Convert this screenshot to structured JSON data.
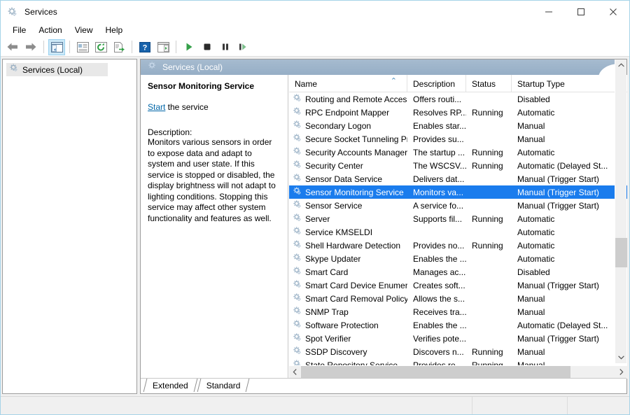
{
  "window": {
    "title": "Services",
    "icon": "services-gear-icon",
    "minimize": "–",
    "maximize": "□",
    "close": "✕"
  },
  "menubar": {
    "items": [
      {
        "label": "File",
        "name": "menu-file"
      },
      {
        "label": "Action",
        "name": "menu-action"
      },
      {
        "label": "View",
        "name": "menu-view"
      },
      {
        "label": "Help",
        "name": "menu-help"
      }
    ]
  },
  "toolbar": {
    "buttons": [
      {
        "name": "back-icon",
        "glyph": "back-arrow"
      },
      {
        "name": "forward-icon",
        "glyph": "forward-arrow"
      },
      {
        "name": "show-hide-console-tree-icon",
        "glyph": "tree-pane",
        "pressed": true
      },
      {
        "name": "properties-icon",
        "glyph": "properties"
      },
      {
        "name": "refresh-icon",
        "glyph": "refresh"
      },
      {
        "name": "export-list-icon",
        "glyph": "export"
      },
      {
        "name": "help-icon",
        "glyph": "question"
      },
      {
        "name": "show-action-pane-icon",
        "glyph": "action-pane"
      },
      {
        "name": "start-service-icon",
        "glyph": "play"
      },
      {
        "name": "stop-service-icon",
        "glyph": "stop"
      },
      {
        "name": "pause-service-icon",
        "glyph": "pause"
      },
      {
        "name": "restart-service-icon",
        "glyph": "restart"
      }
    ]
  },
  "tree": {
    "root": {
      "label": "Services (Local)",
      "icon": "services-gear-icon",
      "selected": true
    }
  },
  "result_header": {
    "label": "Services (Local)",
    "icon": "services-gear-icon"
  },
  "detail": {
    "title": "Sensor Monitoring Service",
    "action_link": "Start",
    "action_suffix": " the service",
    "description_label": "Description:",
    "description": "Monitors various sensors in order to expose data and adapt to system and user state.  If this service is stopped or disabled, the display brightness will not adapt to lighting conditions. Stopping this service may affect other system functionality and features as well."
  },
  "list": {
    "columns": [
      {
        "label": "Name",
        "name": "column-header-name",
        "sorted": true,
        "sort_caret": "⌃"
      },
      {
        "label": "Description",
        "name": "column-header-description",
        "sorted": false
      },
      {
        "label": "Status",
        "name": "column-header-status",
        "sorted": false
      },
      {
        "label": "Startup Type",
        "name": "column-header-startup-type",
        "sorted": false
      }
    ],
    "rows": [
      {
        "name": "Routing and Remote Access",
        "description": "Offers routi...",
        "status": "",
        "startup": "Disabled",
        "selected": false
      },
      {
        "name": "RPC Endpoint Mapper",
        "description": "Resolves RP...",
        "status": "Running",
        "startup": "Automatic",
        "selected": false
      },
      {
        "name": "Secondary Logon",
        "description": "Enables star...",
        "status": "",
        "startup": "Manual",
        "selected": false
      },
      {
        "name": "Secure Socket Tunneling Pr...",
        "description": "Provides su...",
        "status": "",
        "startup": "Manual",
        "selected": false
      },
      {
        "name": "Security Accounts Manager",
        "description": "The startup ...",
        "status": "Running",
        "startup": "Automatic",
        "selected": false
      },
      {
        "name": "Security Center",
        "description": "The WSCSV...",
        "status": "Running",
        "startup": "Automatic (Delayed St...",
        "selected": false
      },
      {
        "name": "Sensor Data Service",
        "description": "Delivers dat...",
        "status": "",
        "startup": "Manual (Trigger Start)",
        "selected": false
      },
      {
        "name": "Sensor Monitoring Service",
        "description": "Monitors va...",
        "status": "",
        "startup": "Manual (Trigger Start)",
        "selected": true
      },
      {
        "name": "Sensor Service",
        "description": "A service fo...",
        "status": "",
        "startup": "Manual (Trigger Start)",
        "selected": false
      },
      {
        "name": "Server",
        "description": "Supports fil...",
        "status": "Running",
        "startup": "Automatic",
        "selected": false
      },
      {
        "name": "Service KMSELDI",
        "description": "",
        "status": "",
        "startup": "Automatic",
        "selected": false
      },
      {
        "name": "Shell Hardware Detection",
        "description": "Provides no...",
        "status": "Running",
        "startup": "Automatic",
        "selected": false
      },
      {
        "name": "Skype Updater",
        "description": "Enables the ...",
        "status": "",
        "startup": "Automatic",
        "selected": false
      },
      {
        "name": "Smart Card",
        "description": "Manages ac...",
        "status": "",
        "startup": "Disabled",
        "selected": false
      },
      {
        "name": "Smart Card Device Enumera...",
        "description": "Creates soft...",
        "status": "",
        "startup": "Manual (Trigger Start)",
        "selected": false
      },
      {
        "name": "Smart Card Removal Policy",
        "description": "Allows the s...",
        "status": "",
        "startup": "Manual",
        "selected": false
      },
      {
        "name": "SNMP Trap",
        "description": "Receives tra...",
        "status": "",
        "startup": "Manual",
        "selected": false
      },
      {
        "name": "Software Protection",
        "description": "Enables the ...",
        "status": "",
        "startup": "Automatic (Delayed St...",
        "selected": false
      },
      {
        "name": "Spot Verifier",
        "description": "Verifies pote...",
        "status": "",
        "startup": "Manual (Trigger Start)",
        "selected": false
      },
      {
        "name": "SSDP Discovery",
        "description": "Discovers n...",
        "status": "Running",
        "startup": "Manual",
        "selected": false
      },
      {
        "name": "State Repository Service",
        "description": "Provides re...",
        "status": "Running",
        "startup": "Manual",
        "selected": false
      }
    ],
    "scroll": {
      "up_arrow": "⌃",
      "down_arrow": "⌄",
      "left_arrow": "‹",
      "right_arrow": "›"
    }
  },
  "tabs": [
    {
      "label": "Extended",
      "name": "tab-extended",
      "active": false
    },
    {
      "label": "Standard",
      "name": "tab-standard",
      "active": true
    }
  ],
  "statusbar": {
    "panel1": "",
    "panel2": "",
    "panel3": ""
  },
  "colors": {
    "selection": "#1a7ced",
    "header_bar": "#9fb6cd",
    "link": "#0066a8",
    "window_border": "#a6d3e8"
  }
}
